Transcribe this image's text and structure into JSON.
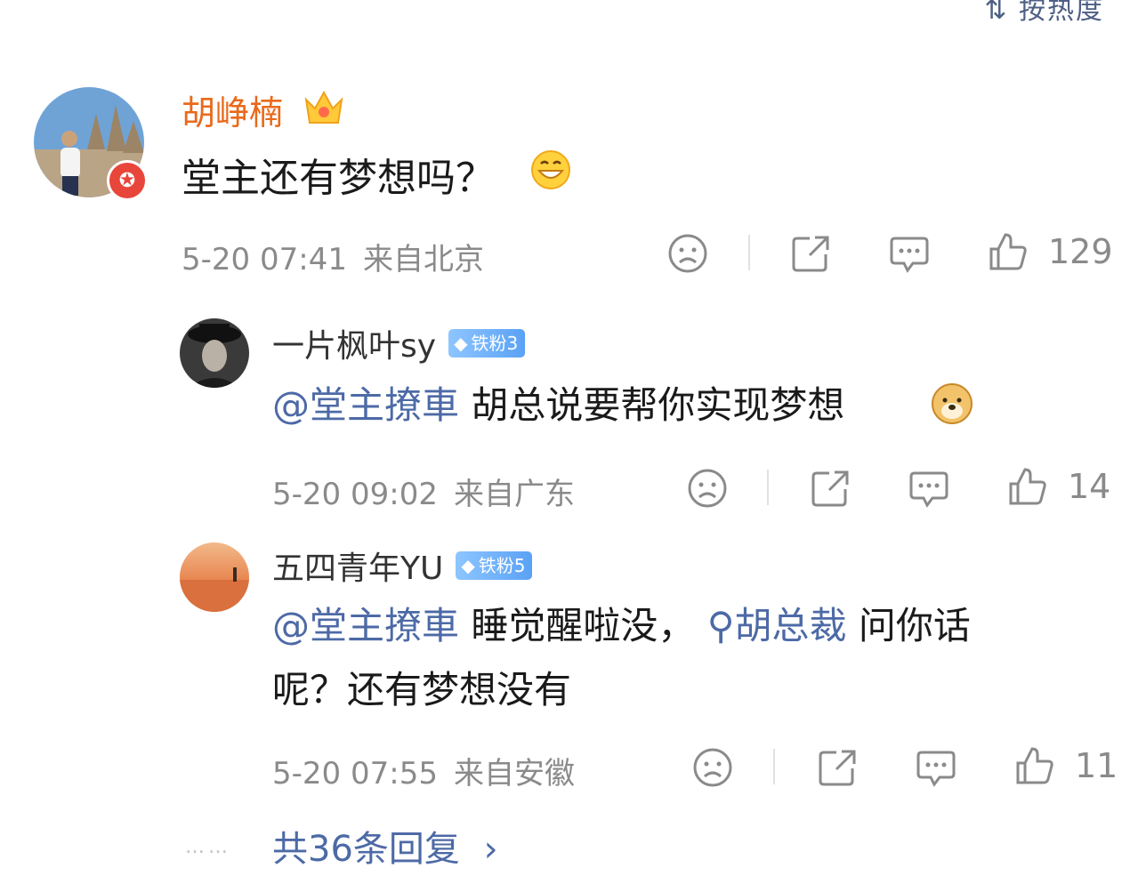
{
  "sort": {
    "label": "按热度"
  },
  "main_comment": {
    "username": "胡峥楠",
    "text": "堂主还有梦想吗？",
    "time": "5-20 07:41",
    "location": "来自北京",
    "likes": "129"
  },
  "replies": [
    {
      "username": "一片枫叶sy",
      "badge": "铁粉3",
      "mention": "@堂主撩車",
      "text": " 胡总说要帮你实现梦想",
      "time": "5-20 09:02",
      "location": "来自广东",
      "likes": "14"
    },
    {
      "username": "五四青年YU",
      "badge": "铁粉5",
      "mention": "@堂主撩車",
      "text_a": " 睡觉醒啦没，",
      "topic": "胡总裁",
      "text_b": " 问你话",
      "text_c": "呢？还有梦想没有",
      "time": "5-20 07:55",
      "location": "来自安徽",
      "likes": "11"
    }
  ],
  "footer": {
    "dots": "……",
    "more": "共36条回复"
  },
  "colors": {
    "username_vip": "#e86a1c",
    "link": "#4d6aa6",
    "meta": "#8a8a8a",
    "badge": "#5aa2f5"
  }
}
